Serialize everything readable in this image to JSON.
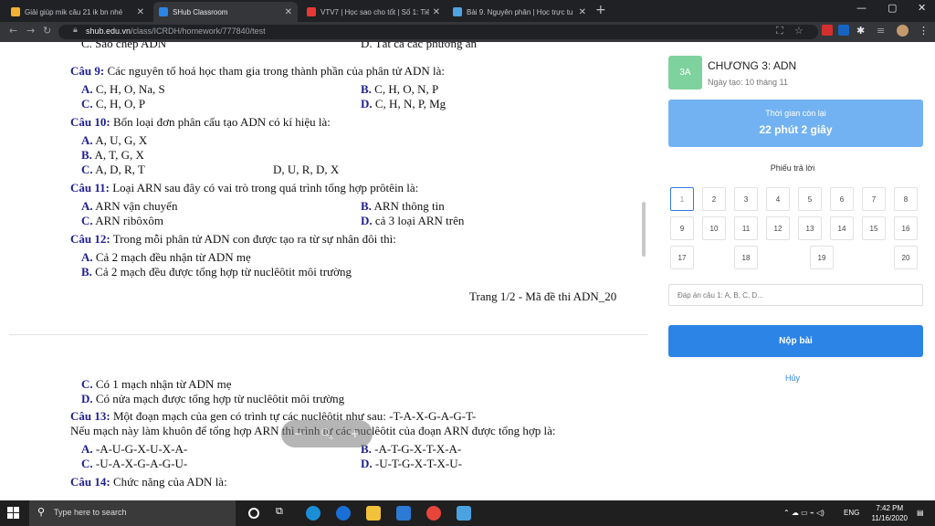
{
  "browser": {
    "tabs": [
      {
        "title": "Giải giúp mik câu 21 ik bn nhé",
        "favicon_color": "#f2b233"
      },
      {
        "title": "SHub Classroom",
        "favicon_color": "#2b84e6"
      },
      {
        "title": "VTV7 | Học sao cho tốt | Số 1: Tiế",
        "favicon_color": "#e53935"
      },
      {
        "title": "Bài 9. Nguyên phân | Học trực tu",
        "favicon_color": "#4fa3e0"
      }
    ],
    "url_host": "shub.edu.vn",
    "url_path": "/class/ICRDH/homework/777840/test"
  },
  "document": {
    "top_cut": [
      "C. Sao chép ADN",
      "D. Tất cả các phương án"
    ],
    "q9": {
      "label": "Câu 9:",
      "text": " Các nguyên tố hoá học tham gia trong thành phần của phân tử ADN là:",
      "A": "C, H, O, Na, S",
      "B": "C, H, O, N, P",
      "C": "C, H, O, P",
      "D": "C, H, N, P, Mg"
    },
    "q10": {
      "label": "Câu 10:",
      "text": " Bốn loại đơn phân cấu tạo ADN có kí hiệu là:",
      "A": "A, U, G, X",
      "B": "A, T, G, X",
      "C": "A, D, R, T",
      "D": "D, U, R, D, X"
    },
    "q11": {
      "label": "Câu 11:",
      "text": " Loại ARN sau đây có vai trò trong quá trình tổng hợp prôtêin là:",
      "A": "ARN vận chuyển",
      "B": "ARN thông tin",
      "C": "ARN ribôxôm",
      "D": "cả 3 loại ARN trên"
    },
    "q12": {
      "label": "Câu 12:",
      "text": " Trong mỗi phân tử ADN con được tạo ra từ sự nhân đôi thì:",
      "A": "Cả 2 mạch đều nhận từ ADN mẹ",
      "B": "Cả 2 mạch đều được tổng hợp từ nuclêôtit môi trường",
      "C": "Có 1 mạch nhận từ ADN mẹ",
      "D": "Có nửa mạch được tổng hợp từ nuclêôtit môi trường"
    },
    "footer": "Trang 1/2 - Mã đề thi ADN_20",
    "q13": {
      "label": "Câu 13:",
      "text": " Một đoạn mạch của gen có trình tự các nuclêôtit như sau: -T-A-X-G-A-G-T-",
      "text2": "Nếu mạch này làm khuôn để tổng hợp ARN thì trình tự các nuclêôtit của đoạn ARN được tổng hợp là:",
      "A": "-A-U-G-X-U-X-A-",
      "B": "-A-T-G-X-T-X-A-",
      "C": "-U-A-X-G-A-G-U-",
      "D": "-U-T-G-X-T-X-U-"
    },
    "q14": {
      "label": "Câu 14:",
      "text": " Chức năng của ADN là:"
    },
    "opt": {
      "A": "A.",
      "B": "B.",
      "C": "C.",
      "D": "D."
    },
    "zoom": {
      "minus": "−",
      "plus": "+"
    }
  },
  "panel": {
    "badge": "3A",
    "chapter": "CHƯƠNG 3: ADN",
    "created": "Ngày tạo: 10 tháng 11",
    "timer_label": "Thời gian còn lại",
    "timer_value": "22 phút 2 giây",
    "sheet_title": "Phiếu trả lời",
    "questions": [
      "1",
      "2",
      "3",
      "4",
      "5",
      "6",
      "7",
      "8",
      "9",
      "10",
      "11",
      "12",
      "13",
      "14",
      "15",
      "16",
      "17",
      "18",
      "19",
      "20"
    ],
    "answer_placeholder": "Đáp án câu 1: A, B, C, D...",
    "submit": "Nộp bài",
    "cancel": "Hủy"
  },
  "taskbar": {
    "search_placeholder": "Type here to search",
    "lang": "ENG",
    "time": "7:42 PM",
    "date": "11/16/2020"
  }
}
